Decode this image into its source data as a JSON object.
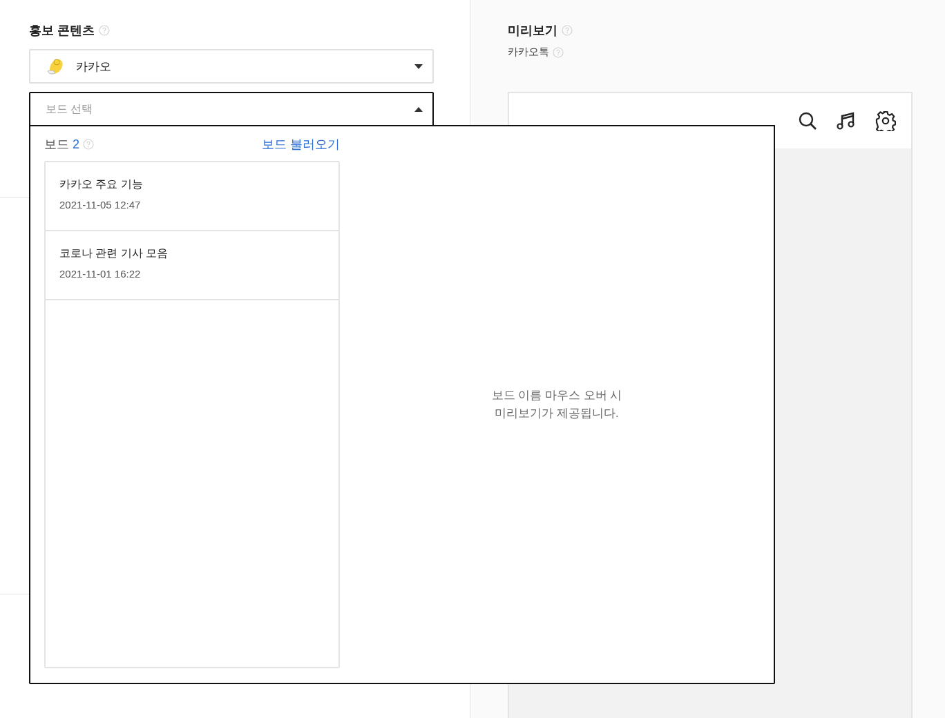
{
  "content_section": {
    "title": "홍보 콘텐츠",
    "channel_select": {
      "value": "카카오",
      "expanded": false
    },
    "board_select": {
      "placeholder": "보드 선택",
      "expanded": true
    }
  },
  "board_dropdown": {
    "label": "보드",
    "count": "2",
    "load_link": "보드 불러오기",
    "boards": [
      {
        "name": "카카오 주요 기능",
        "date": "2021-11-05 12:47"
      },
      {
        "name": "코로나 관련 기사 모음",
        "date": "2021-11-01 16:22"
      }
    ],
    "hint": "보드 이름 마우스 오버 시\n미리보기가 제공됩니다."
  },
  "preview": {
    "title": "미리보기",
    "platform": "카카오톡"
  }
}
